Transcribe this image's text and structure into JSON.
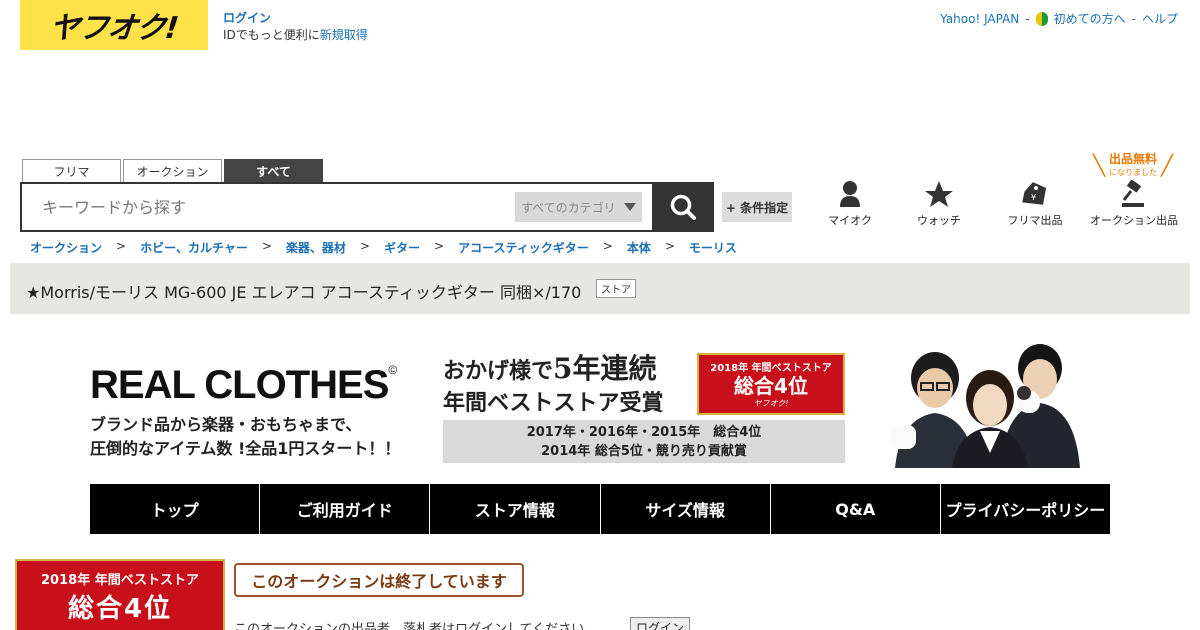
{
  "header": {
    "logo_text": "ヤフオク!",
    "login_label": "ログイン",
    "login_sub_prefix": "IDでもっと便利に",
    "register_label": "新規取得",
    "yahoo_japan": "Yahoo! JAPAN",
    "sep": "-",
    "beginner": "初めての方へ",
    "help": "ヘルプ"
  },
  "search": {
    "tabs": [
      "フリマ",
      "オークション",
      "すべて"
    ],
    "active_tab": "すべて",
    "placeholder": "キーワードから探す",
    "category": "すべてのカテゴリ",
    "condition_button": "+ 条件指定"
  },
  "icon_nav": {
    "my": "マイオク",
    "watch": "ウォッチ",
    "flea_sell": "フリマ出品",
    "auction_sell": "オークション出品",
    "free_listing": "出品無料",
    "free_listing_sub": "になりました"
  },
  "breadcrumb": [
    "オークション",
    "ホビー、カルチャー",
    "楽器、器材",
    "ギター",
    "アコースティックギター",
    "本体",
    "モーリス"
  ],
  "breadcrumb_sep": ">",
  "item": {
    "title": "★Morris/モーリス MG-600 JE エレアコ アコースティックギター 同梱×/170",
    "store_badge": "ストア"
  },
  "banner": {
    "logo": "REAL CLOTHES",
    "copyright": "©",
    "sub_line1": "ブランド品から楽器・おもちゃまで、",
    "sub_line2": "圧倒的なアイテム数 !全品1円スタート！！",
    "main_line1_a": "おかげ様で",
    "main_line1_num": "5年連続",
    "main_line2": "年間ベストストア受賞",
    "award_line1": "2018年 年間ベストストア",
    "award_line2": "総合4位",
    "award_line3": "ヤフオク!",
    "strip_line1": "2017年・2016年・2015年　総合4位",
    "strip_line2": "2014年 総合5位・競り売り貢献賞"
  },
  "store_nav": [
    "トップ",
    "ご利用ガイド",
    "ストア情報",
    "サイズ情報",
    "Q&A",
    "プライバシーポリシー"
  ],
  "bottom": {
    "award_line1": "2018年 年間ベストストア",
    "award_line2": "総合4位",
    "ended": "このオークションは終了しています",
    "login_msg": "このオークションの出品者、落札者はログインしてください。",
    "login_button": "ログイン"
  },
  "colors": {
    "logo_bg": "#ffe14a",
    "link": "#1a6fb5",
    "award_red": "#c8101a",
    "nav_black": "#000000"
  }
}
